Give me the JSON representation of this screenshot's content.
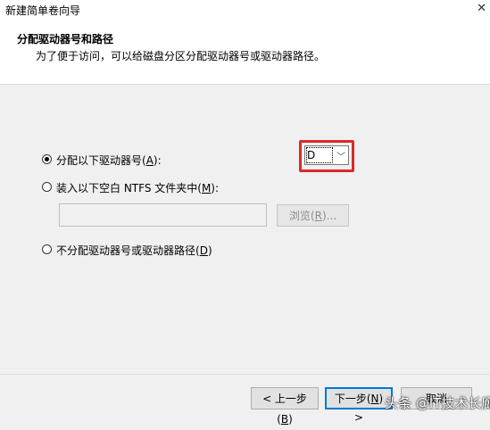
{
  "window": {
    "title": "新建简单卷向导",
    "close_glyph": "✕"
  },
  "header": {
    "title": "分配驱动器号和路径",
    "description": "为了便于访问，可以给磁盘分区分配驱动器号或驱动器路径。"
  },
  "options": {
    "assign_letter": {
      "label_pre": "分配以下驱动器号(",
      "mnemonic": "A",
      "label_post": "):",
      "selected": true
    },
    "mount_folder": {
      "label_pre": "装入以下空白 NTFS 文件夹中(",
      "mnemonic": "M",
      "label_post": "):",
      "selected": false
    },
    "no_assign": {
      "label_pre": "不分配驱动器号或驱动器路径(",
      "mnemonic": "D",
      "label_post": ")",
      "selected": false
    }
  },
  "drive_select": {
    "value": "D",
    "chevron": "﹀"
  },
  "folder_path": {
    "value": ""
  },
  "browse": {
    "label_pre": "浏览(",
    "mnemonic": "R",
    "label_post": ")..."
  },
  "footer": {
    "back": {
      "label_pre": "< 上一步(",
      "mnemonic": "B",
      "label_post": ")"
    },
    "next": {
      "label_pre": "下一步(",
      "mnemonic": "N",
      "label_post": ") >"
    },
    "cancel": {
      "label": "取消"
    }
  },
  "watermark": "头条 @IT技术长廊"
}
